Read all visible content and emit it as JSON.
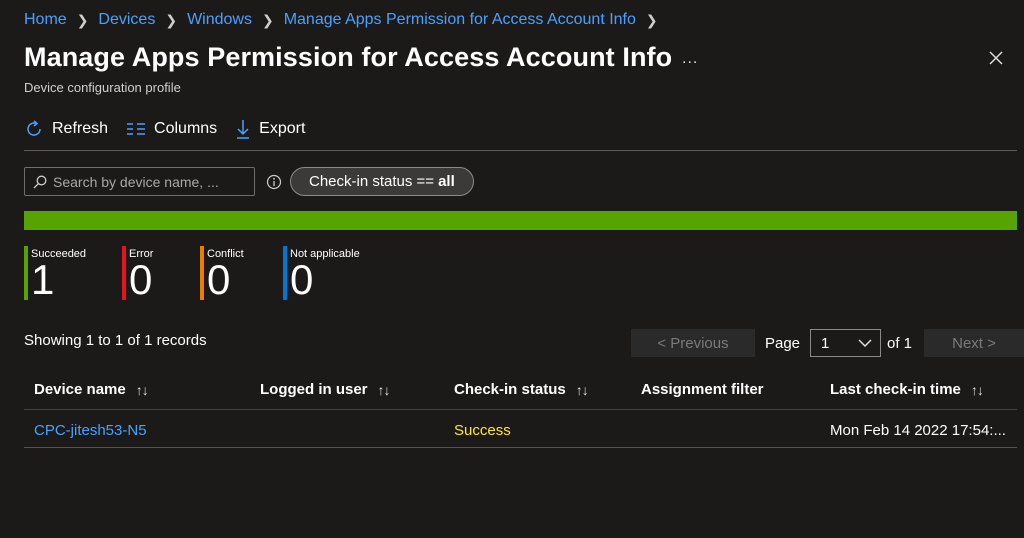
{
  "breadcrumb": [
    "Home",
    "Devices",
    "Windows",
    "Manage Apps Permission for Access Account Info"
  ],
  "title": "Manage Apps Permission for Access Account Info",
  "more_label": "...",
  "subtitle": "Device configuration profile",
  "toolbar": {
    "refresh": "Refresh",
    "columns": "Columns",
    "export": "Export"
  },
  "search": {
    "placeholder": "Search by device name, ..."
  },
  "filter": {
    "prefix": "Check-in status ==",
    "value": "all"
  },
  "colors": {
    "success": "#57a300",
    "error": "#e81123",
    "conflict": "#ea7e00",
    "na": "#0078d4",
    "link": "#4aa0ff"
  },
  "progress": {
    "succeeded_fraction": 1.0
  },
  "stats": [
    {
      "label": "Succeeded",
      "value": "1"
    },
    {
      "label": "Error",
      "value": "0"
    },
    {
      "label": "Conflict",
      "value": "0"
    },
    {
      "label": "Not applicable",
      "value": "0"
    }
  ],
  "records": "Showing 1 to 1 of 1 records",
  "pager": {
    "previous": "< Previous",
    "page_label": "Page",
    "page": "1",
    "of_label": "of 1",
    "next": "Next >"
  },
  "table": {
    "headers": [
      "Device name",
      "Logged in user",
      "Check-in status",
      "Assignment filter",
      "Last check-in time"
    ],
    "rows": [
      {
        "device": "CPC-jitesh53-N5",
        "user": "",
        "status": "Success",
        "filter": "",
        "last": "Mon Feb 14 2022 17:54:..."
      }
    ]
  }
}
